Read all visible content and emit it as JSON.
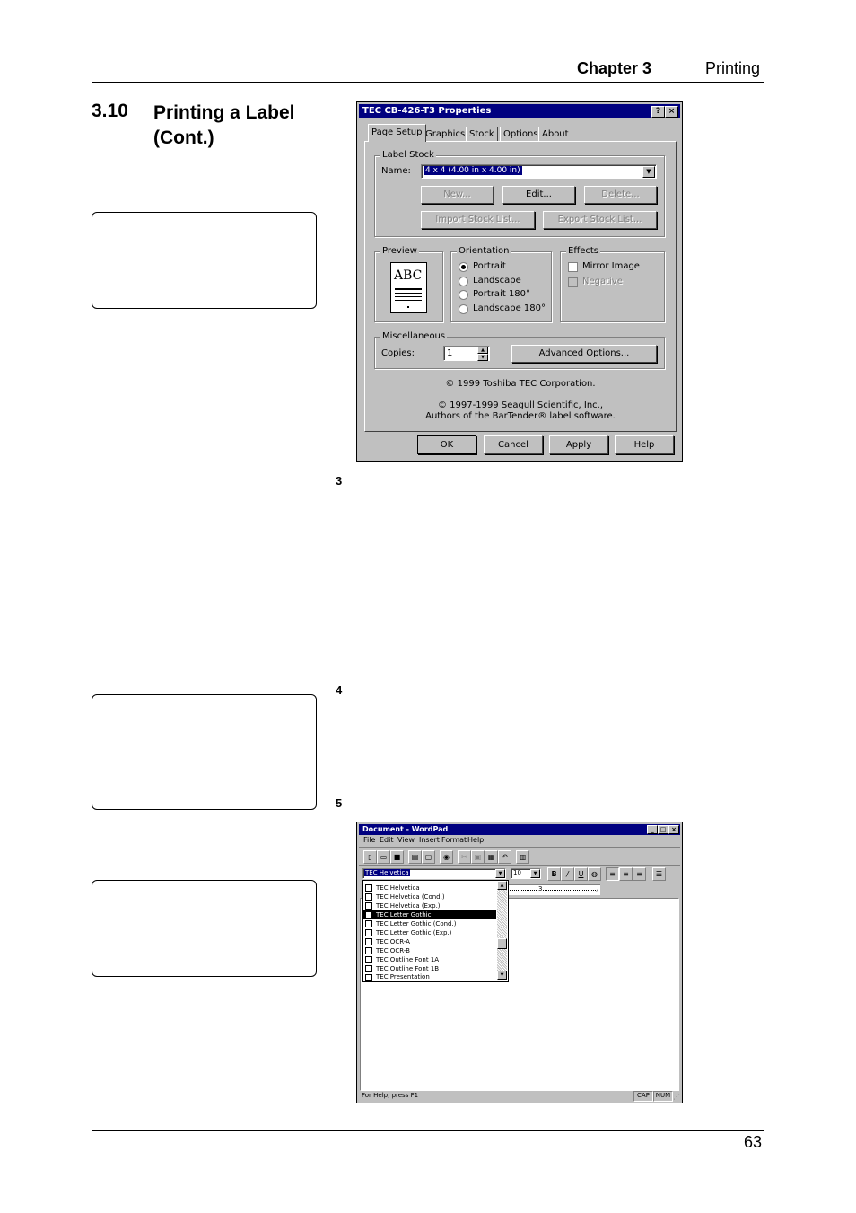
{
  "header": {
    "chapter": "Chapter 3",
    "section": "Printing"
  },
  "section": {
    "number": "3.10",
    "title_line1": "Printing a Label",
    "title_line2": "(Cont.)"
  },
  "steps": {
    "s3": "3",
    "s4": "4",
    "s5": "5"
  },
  "footer": {
    "page": "63"
  },
  "dialog": {
    "title": "TEC CB-426-T3 Properties",
    "title_buttons": [
      "?",
      "×"
    ],
    "tabs": [
      "Page Setup",
      "Graphics",
      "Stock",
      "Options",
      "About"
    ],
    "label_stock": {
      "group": "Label Stock",
      "name_label": "Name:",
      "name_value": "4 x 4 (4.00 in x 4.00 in)",
      "buttons": [
        "New...",
        "Edit...",
        "Delete...",
        "Import Stock List...",
        "Export Stock List..."
      ]
    },
    "preview": {
      "group": "Preview",
      "sample": "ABC"
    },
    "orientation": {
      "group": "Orientation",
      "options": [
        "Portrait",
        "Landscape",
        "Portrait 180°",
        "Landscape 180°"
      ],
      "selected": 0
    },
    "effects": {
      "group": "Effects",
      "mirror": "Mirror Image",
      "negative": "Negative"
    },
    "misc": {
      "group": "Miscellaneous",
      "copies_label": "Copies:",
      "copies_value": "1",
      "advanced": "Advanced Options..."
    },
    "copyright1": "© 1999 Toshiba TEC Corporation.",
    "copyright2": "© 1997-1999 Seagull Scientific, Inc.,",
    "copyright3": "Authors of the BarTender® label software.",
    "bottom_buttons": [
      "OK",
      "Cancel",
      "Apply",
      "Help"
    ]
  },
  "wordpad": {
    "title": "Document - WordPad",
    "title_buttons": [
      "_",
      "□",
      "×"
    ],
    "menu": [
      "File",
      "Edit",
      "View",
      "Insert",
      "Format",
      "Help"
    ],
    "font_value": "TEC Helvetica",
    "size_value": "10",
    "format_buttons": [
      "B",
      "/",
      "U"
    ],
    "fonts": [
      "TEC Helvetica",
      "TEC Helvetica (Cond.)",
      "TEC Helvetica (Exp.)",
      "TEC Letter Gothic",
      "TEC Letter Gothic (Cond.)",
      "TEC Letter Gothic (Exp.)",
      "TEC OCR-A",
      "TEC OCR-B",
      "TEC Outline Font 1A",
      "TEC Outline Font 1B",
      "TEC Presentation"
    ],
    "selected_font": 3,
    "ruler_mark": "3",
    "status": "For Help, press F1",
    "status_cap": "CAP",
    "status_num": "NUM"
  }
}
